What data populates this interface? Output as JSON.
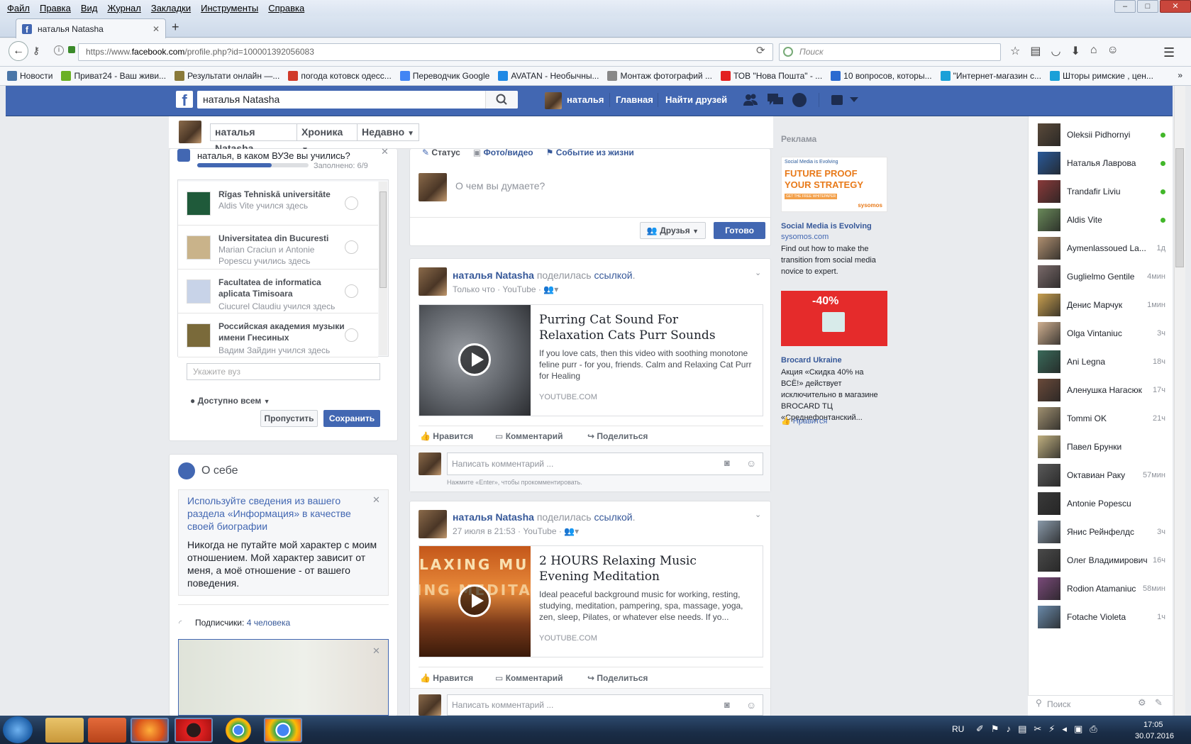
{
  "browser": {
    "menu": [
      "Файл",
      "Правка",
      "Вид",
      "Журнал",
      "Закладки",
      "Инструменты",
      "Справка"
    ],
    "tab_title": "наталья Natasha",
    "url_prefix": "https://www.",
    "url_domain": "facebook.com",
    "url_path": "/profile.php?id=100001392056083",
    "search_placeholder": "Поиск",
    "bookmarks": [
      {
        "label": "Новости",
        "color": "#4a76a8"
      },
      {
        "label": "Приват24 - Ваш живи...",
        "color": "#6ab023"
      },
      {
        "label": "Результати онлайн —...",
        "color": "#8a7a3a"
      },
      {
        "label": "погода котовск одесс...",
        "color": "#d03a2a"
      },
      {
        "label": "Переводчик Google",
        "color": "#4285f4"
      },
      {
        "label": "AVATAN - Необычны...",
        "color": "#1e88e5"
      },
      {
        "label": "Монтаж фотографий ...",
        "color": "#888888"
      },
      {
        "label": "ТОВ \"Нова Пошта\" - ...",
        "color": "#e32020"
      },
      {
        "label": "10 вопросов, которы...",
        "color": "#2a6ad0"
      },
      {
        "label": "\"Интернет-магазин с...",
        "color": "#1aa0d8"
      },
      {
        "label": "Шторы римские , цен...",
        "color": "#1aa0d8"
      }
    ]
  },
  "fb": {
    "search_value": "наталья Natasha",
    "user_name": "наталья",
    "nav_home": "Главная",
    "nav_find_friends": "Найти друзей"
  },
  "profile_bar": {
    "name": "наталья Natasha",
    "timeline": "Хроника",
    "recent": "Недавно"
  },
  "education": {
    "question": "наталья, в каком ВУЗе вы учились?",
    "progress_text": "Заполнено: 6/9",
    "progress_fraction": 0.67,
    "schools": [
      {
        "name": "Rīgas Tehniskā universitāte",
        "line2": "",
        "sub": "Aldis Vite учился здесь",
        "color": "#1f5a3a"
      },
      {
        "name": "Universitatea din Bucuresti",
        "line2": "",
        "sub": "Marian Craciun и Antonie Popescu учились здесь",
        "color": "#c9b38a"
      },
      {
        "name": "Facultatea de informatica",
        "line2": "aplicata Timisoara",
        "sub": "Ciucurel Claudiu учился здесь",
        "color": "#c8d3e8"
      },
      {
        "name": "Российская академия музыки",
        "line2": "имени Гнесиных",
        "sub": "Вадим Зайдин учился здесь",
        "color": "#7a6a3a"
      }
    ],
    "input_placeholder": "Укажите вуз",
    "privacy": "Доступно всем",
    "skip": "Пропустить",
    "save": "Сохранить"
  },
  "about": {
    "title": "О себе",
    "hint": "Используйте сведения из вашего раздела «Информация» в качестве своей биографии",
    "bio": "Никогда не путайте мой характер с моим отношением. Мой характер зависит от меня, а моё отношение - от вашего поведения.",
    "followers_label": "Подписчики:",
    "followers_value": "4 человека"
  },
  "composer": {
    "tab_status": "Статус",
    "tab_photo": "Фото/видео",
    "tab_event": "Событие из жизни",
    "placeholder": "О чем вы думаете?",
    "audience": "Друзья",
    "done": "Готово"
  },
  "posts": [
    {
      "author": "наталья Natasha",
      "shared": "поделилась",
      "link_word": "ссылкой",
      "dot": ".",
      "time": "Только что",
      "via": "YouTube",
      "title": "Purring Cat Sound For Relaxation Cats Purr Sounds",
      "desc": "If you love cats, then this video with soothing monotone feline purr - for you, friends. Calm and Relaxing Cat Purr for Healing",
      "domain": "YOUTUBE.COM",
      "like": "Нравится",
      "comment": "Комментарий",
      "share": "Поделиться",
      "comment_placeholder": "Написать комментарий ...",
      "enter_hint": "Нажмите «Enter», чтобы прокомментировать."
    },
    {
      "author": "наталья Natasha",
      "shared": "поделилась",
      "link_word": "ссылкой",
      "dot": ".",
      "time": "27 июля в 21:53",
      "via": "YouTube",
      "thumb_text1": "LAXING MU",
      "thumb_text2": "ING MEDITAT",
      "title": "2 HOURS Relaxing Music Evening Meditation",
      "desc": "Ideal peaceful background music for working, resting, studying, meditation, pampering, spa, massage, yoga, zen, sleep, Pilates, or whatever else needs. If yo...",
      "domain": "YOUTUBE.COM",
      "like": "Нравится",
      "comment": "Комментарий",
      "share": "Поделиться",
      "comment_placeholder": "Написать комментарий ..."
    }
  ],
  "ads": {
    "header": "Реклама",
    "ad1": {
      "title": "Social Media is Evolving",
      "domain": "sysomos.com",
      "body": "Find out how to make the transition from social media novice to expert.",
      "img_top": "Social Media is Evolving",
      "img_line1": "FUTURE PROOF",
      "img_line2": "YOUR STRATEGY",
      "img_cta": "GET THE FREE WHITEPAPER",
      "img_brand": "sysomos"
    },
    "ad2": {
      "title": "Brocard Ukraine",
      "body": "Акция «Скидка 40% на ВСЁ!» действует исключительно в магазине BROCARD ТЦ «Среднефонтанский...",
      "img_text": "-40%",
      "like": "Нравится"
    }
  },
  "chat": {
    "contacts": [
      {
        "name": "Oleksii Pidhornyi",
        "time": "",
        "online": true,
        "color": "#5a4a3a"
      },
      {
        "name": "Наталья Лаврова",
        "time": "",
        "online": true,
        "color": "#2a5a9a"
      },
      {
        "name": "Trandafir Liviu",
        "time": "",
        "online": true,
        "color": "#8a3a3a"
      },
      {
        "name": "Aldis Vite",
        "time": "",
        "online": true,
        "color": "#6a8a5a"
      },
      {
        "name": "Aymenlassoued La...",
        "time": "1д",
        "online": false,
        "color": "#b09070"
      },
      {
        "name": "Guglielmo Gentile",
        "time": "4мин",
        "online": false,
        "color": "#7a6a6a"
      },
      {
        "name": "Денис Марчук",
        "time": "1мин",
        "online": false,
        "color": "#c9a050"
      },
      {
        "name": "Olga Vintaniuc",
        "time": "3ч",
        "online": false,
        "color": "#d0b090"
      },
      {
        "name": "Ani Legna",
        "time": "18ч",
        "online": false,
        "color": "#3a6a5a"
      },
      {
        "name": "Аленушка Нагасюк",
        "time": "17ч",
        "online": false,
        "color": "#6a4a3a"
      },
      {
        "name": "Tommi OK",
        "time": "21ч",
        "online": false,
        "color": "#a09070"
      },
      {
        "name": "Павел Брунки",
        "time": "",
        "online": false,
        "color": "#c0b080"
      },
      {
        "name": "Октавиан Раку",
        "time": "57мин",
        "online": false,
        "color": "#5a5a5a"
      },
      {
        "name": "Antonie Popescu",
        "time": "",
        "online": false,
        "color": "#3a3a3a"
      },
      {
        "name": "Янис Рейнфелдс",
        "time": "3ч",
        "online": false,
        "color": "#8a9aaa"
      },
      {
        "name": "Олег Владимирович",
        "time": "16ч",
        "online": false,
        "color": "#4a4a4a"
      },
      {
        "name": "Rodion Atamaniuc",
        "time": "58мин",
        "online": false,
        "color": "#7a4a7a"
      },
      {
        "name": "Fotache Violeta",
        "time": "1ч",
        "online": false,
        "color": "#6a8aaa"
      }
    ],
    "search_placeholder": "Поиск"
  },
  "taskbar": {
    "lang": "RU",
    "time": "17:05",
    "date": "30.07.2016"
  }
}
